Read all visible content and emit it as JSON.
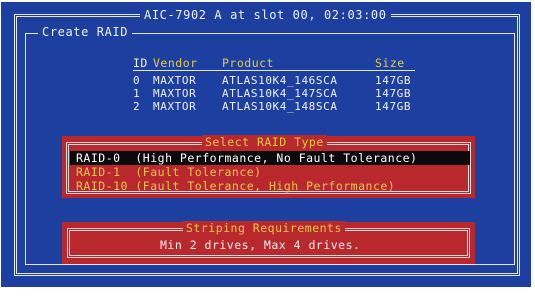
{
  "window": {
    "title": "AIC-7902 A at slot 00, 02:03:00"
  },
  "panel": {
    "title": "Create RAID"
  },
  "drive_table": {
    "columns": [
      "ID",
      "Vendor",
      "Product",
      "Size"
    ],
    "rows": [
      {
        "id": "0",
        "vendor": "MAXTOR",
        "product": "ATLAS10K4_146SCA",
        "size": "147GB"
      },
      {
        "id": "1",
        "vendor": "MAXTOR",
        "product": "ATLAS10K4_147SCA",
        "size": "147GB"
      },
      {
        "id": "2",
        "vendor": "MAXTOR",
        "product": "ATLAS10K4_148SCA",
        "size": "147GB"
      }
    ]
  },
  "raid_dialog": {
    "title": "Select RAID Type",
    "selected_index": 0,
    "options": [
      "RAID-0  (High Performance, No Fault Tolerance)",
      "RAID-1  (Fault Tolerance)",
      "RAID-10 (Fault Tolerance, High Performance)"
    ]
  },
  "striping_dialog": {
    "title": "Striping Requirements",
    "message": "Min 2 drives, Max 4 drives."
  },
  "colors": {
    "background": "#1c3fa0",
    "dialog": "#b9282d",
    "highlight_text": "#e8c84a",
    "text": "#f0f0f0",
    "selection": "#0a0a0a"
  }
}
